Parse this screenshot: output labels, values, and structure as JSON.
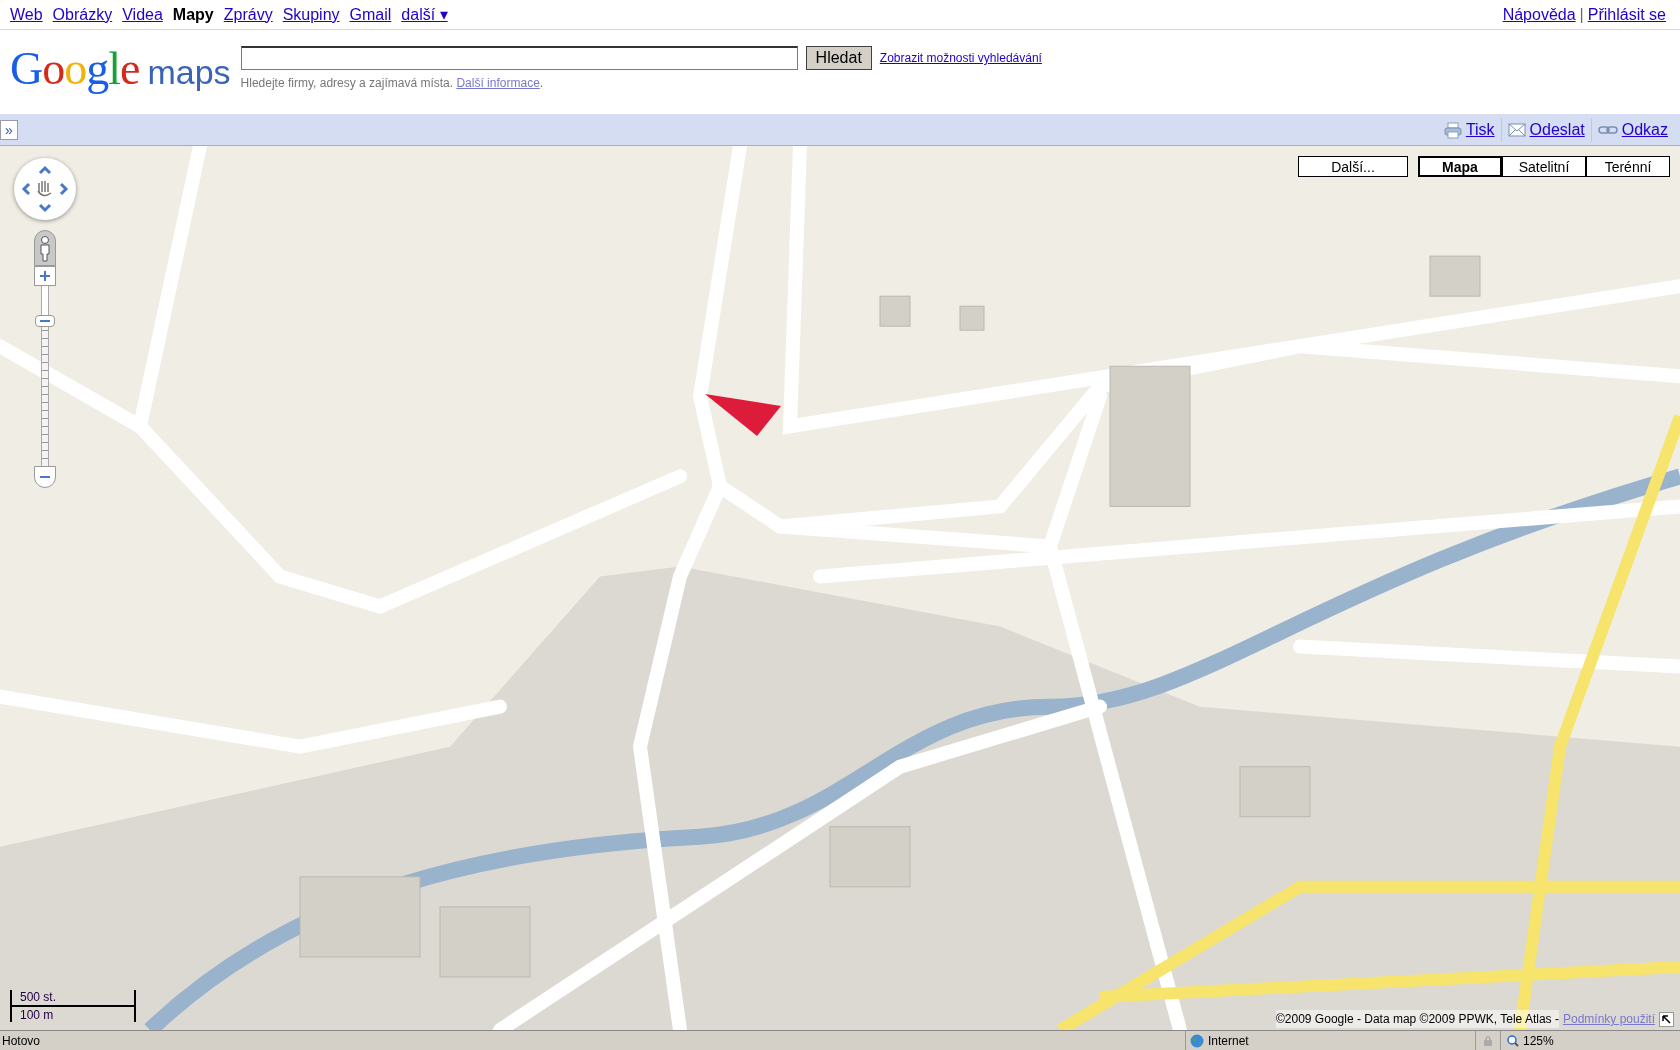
{
  "top_nav": {
    "items": [
      {
        "label": "Web",
        "selected": false
      },
      {
        "label": "Obrázky",
        "selected": false
      },
      {
        "label": "Videa",
        "selected": false
      },
      {
        "label": "Mapy",
        "selected": true
      },
      {
        "label": "Zprávy",
        "selected": false
      },
      {
        "label": "Skupiny",
        "selected": false
      },
      {
        "label": "Gmail",
        "selected": false
      },
      {
        "label": "další ▾",
        "selected": false
      }
    ],
    "right_links": [
      "Nápověda",
      "Přihlásit se"
    ],
    "separator": "|"
  },
  "logo": {
    "brand": "Google",
    "product": "maps"
  },
  "search": {
    "button": "Hledat",
    "options_link": "Zobrazit možnosti vyhledávání",
    "hint": "Hledejte firmy, adresy a zajímavá místa.",
    "hint_link": "Další informace",
    "hint_end": "."
  },
  "toolbar": {
    "toggle": "»",
    "actions": [
      {
        "kind": "print",
        "label": "Tisk"
      },
      {
        "kind": "mail",
        "label": "Odeslat"
      },
      {
        "kind": "link",
        "label": "Odkaz"
      }
    ]
  },
  "map": {
    "more_button": "Další...",
    "map_types": [
      {
        "label": "Mapa",
        "selected": true
      },
      {
        "label": "Satelitní",
        "selected": false
      },
      {
        "label": "Terénní",
        "selected": false
      }
    ],
    "zoom": {
      "level": 0.84
    },
    "scale": {
      "imperial": "500 st.",
      "metric": "100 m"
    },
    "copyright": "©2009 Google - Data map ©2009 PPWK, Tele Atlas -",
    "terms_link": "Podmínky použití"
  },
  "status_bar": {
    "status": "Hotovo",
    "zone": "Internet",
    "zoom": "125%"
  }
}
